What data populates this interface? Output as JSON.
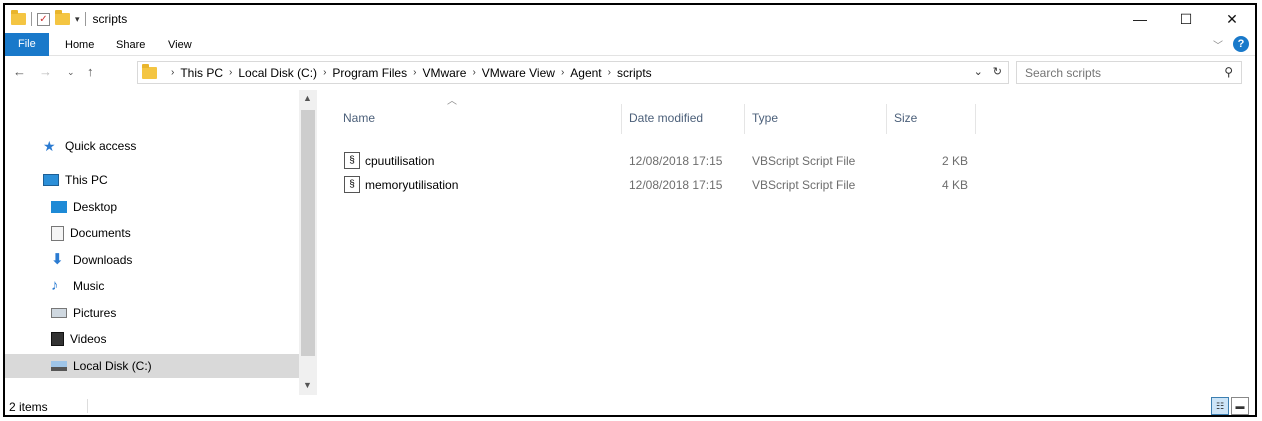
{
  "window": {
    "title": "scripts",
    "controls": {
      "minimize": "—",
      "maximize": "☐",
      "close": "✕"
    }
  },
  "ribbon": {
    "tabs": [
      "File",
      "Home",
      "Share",
      "View"
    ]
  },
  "address_bar": {
    "breadcrumbs": [
      "This PC",
      "Local Disk (C:)",
      "Program Files",
      "VMware",
      "VMware View",
      "Agent",
      "scripts"
    ]
  },
  "search": {
    "placeholder": "Search scripts"
  },
  "nav_pane": {
    "items": [
      {
        "label": "Quick access",
        "icon": "star-icon"
      },
      {
        "label": "This PC",
        "icon": "computer-icon"
      },
      {
        "label": "Desktop",
        "icon": "desktop-icon"
      },
      {
        "label": "Documents",
        "icon": "documents-icon"
      },
      {
        "label": "Downloads",
        "icon": "downloads-icon"
      },
      {
        "label": "Music",
        "icon": "music-icon"
      },
      {
        "label": "Pictures",
        "icon": "pictures-icon"
      },
      {
        "label": "Videos",
        "icon": "videos-icon"
      },
      {
        "label": "Local Disk (C:)",
        "icon": "drive-icon",
        "selected": true
      }
    ]
  },
  "file_list": {
    "columns": [
      "Name",
      "Date modified",
      "Type",
      "Size"
    ],
    "rows": [
      {
        "name": "cpuutilisation",
        "date": "12/08/2018 17:15",
        "type": "VBScript Script File",
        "size": "2 KB"
      },
      {
        "name": "memoryutilisation",
        "date": "12/08/2018 17:15",
        "type": "VBScript Script File",
        "size": "4 KB"
      }
    ]
  },
  "status": {
    "item_count": "2 items"
  },
  "colors": {
    "accent": "#1979ca",
    "selected_bg": "#d9d9d9",
    "column_header": "#4c607a"
  }
}
